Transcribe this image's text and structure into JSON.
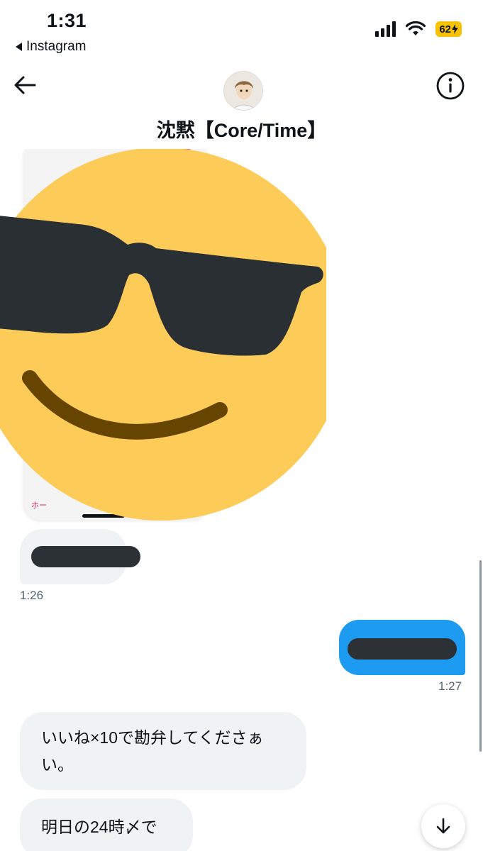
{
  "status_bar": {
    "time": "1:31",
    "back_app": "Instagram",
    "battery": "62"
  },
  "header": {
    "title": "沈黙【Core/Time】"
  },
  "messages": [
    {
      "direction": "incoming",
      "content": "image",
      "redacted": true
    },
    {
      "direction": "incoming",
      "redacted": true,
      "time": "1:26"
    },
    {
      "direction": "outgoing",
      "redacted": true,
      "time": "1:27"
    },
    {
      "direction": "incoming",
      "lines": [
        "いいね×10で勘弁してくださぁ",
        "い。"
      ]
    },
    {
      "direction": "incoming",
      "lines": [
        "明日の24時〆で"
      ]
    }
  ],
  "colors": {
    "outgoing_bubble": "#1d9bf0",
    "incoming_bubble": "#eff3f4",
    "battery": "#f7c300",
    "emoji_face": "#fdcb58",
    "emoji_glasses": "#292f33",
    "emoji_mouth": "#664500"
  },
  "icons": {
    "back": "back-arrow-icon",
    "info": "info-icon",
    "scroll_down": "arrow-down-icon"
  }
}
